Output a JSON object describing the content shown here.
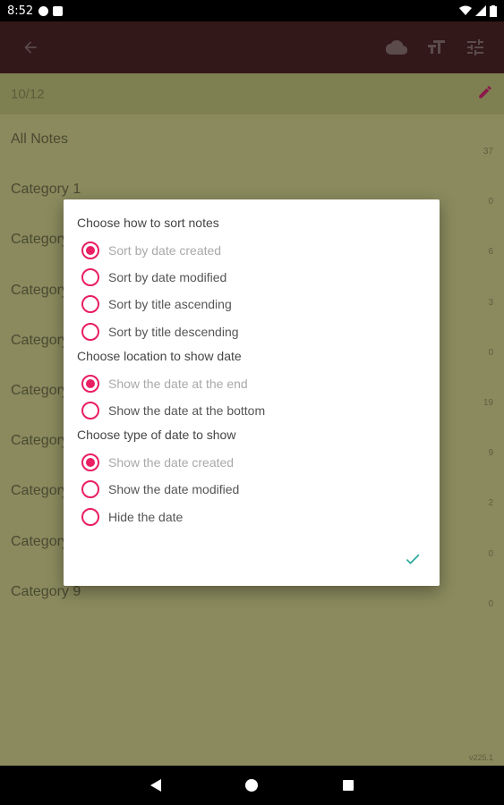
{
  "status_bar": {
    "time": "8:52"
  },
  "toolbar": {
    "back_icon": "arrow-left-icon",
    "cloud_icon": "cloud-icon",
    "text_size_icon": "text-size-icon",
    "settings_icon": "tune-icon"
  },
  "list": {
    "date_header": "10/12",
    "categories": [
      {
        "name": "All Notes",
        "count": "37"
      },
      {
        "name": "Category 1",
        "count": "0"
      },
      {
        "name": "Category 2",
        "count": "6"
      },
      {
        "name": "Category 3",
        "count": "3"
      },
      {
        "name": "Category 4",
        "count": "0"
      },
      {
        "name": "Category 5",
        "count": "19"
      },
      {
        "name": "Category 6",
        "count": "9"
      },
      {
        "name": "Category 7",
        "count": "2"
      },
      {
        "name": "Category 8",
        "count": "0"
      },
      {
        "name": "Category 9",
        "count": "0"
      }
    ],
    "version": "v225.1"
  },
  "dialog": {
    "sort_title": "Choose how to sort notes",
    "sort_options": [
      "Sort by date created",
      "Sort by date modified",
      "Sort by title ascending",
      "Sort by title descending"
    ],
    "location_title": "Choose location to show date",
    "location_options": [
      "Show the date at the end",
      "Show the date at the bottom"
    ],
    "type_title": "Choose type of date to show",
    "type_options": [
      "Show the date created",
      "Show the date modified",
      "Hide the date"
    ]
  },
  "colors": {
    "accent": "#e91e63",
    "confirm": "#26a69a",
    "app_bar": "#321818"
  }
}
